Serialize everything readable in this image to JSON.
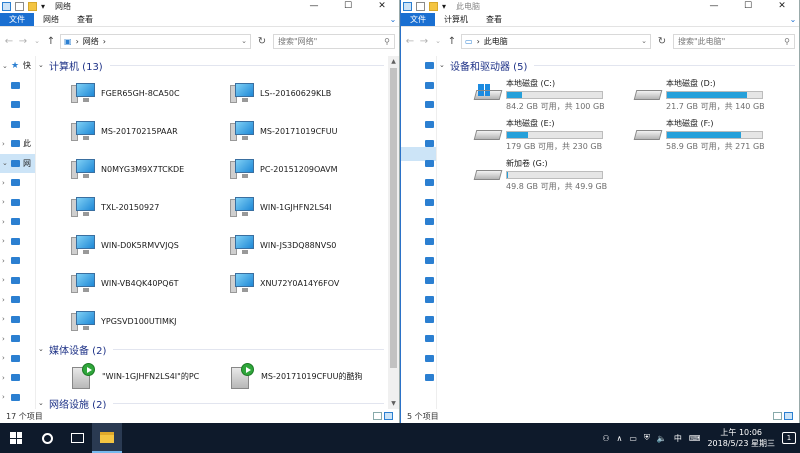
{
  "left_window": {
    "title": "网络",
    "ribbon_tabs": [
      "文件",
      "网络",
      "查看"
    ],
    "address": "网络",
    "search_placeholder": "搜索\"网络\"",
    "groups": {
      "computers": "计算机 (13)",
      "media": "媒体设备 (2)",
      "infra": "网络设施 (2)"
    },
    "computers": [
      "FGER65GH-8CA50C",
      "LS--20160629KLB",
      "MS-20170215PAAR",
      "MS-20171019CFUU",
      "N0MYG3M9X7TCKDE",
      "PC-20151209OAVM",
      "TXL-20150927",
      "WIN-1GJHFN2LS4I",
      "WIN-D0K5RMVVJQS",
      "WIN-JS3DQ88NVS0",
      "WIN-VB4QK40PQ6T",
      "XNU72Y0A14Y6FOV",
      "YPGSVD100UTIMKJ"
    ],
    "media": [
      "\"WIN-1GJHFN2LS4I\"的PC",
      "MS-20171019CFUU的酷狗"
    ],
    "nav_items": [
      "快",
      "",
      "",
      "",
      "此",
      "网",
      "",
      "",
      "",
      "",
      "",
      "",
      "",
      "",
      "",
      "",
      "",
      ""
    ],
    "status": "17 个项目"
  },
  "right_window": {
    "title": "此电脑",
    "ribbon_tabs": [
      "文件",
      "计算机",
      "查看"
    ],
    "address": "此电脑",
    "search_placeholder": "搜索\"此电脑\"",
    "group": "设备和驱动器 (5)",
    "drives": [
      {
        "name": "本地磁盘 (C:)",
        "free": "84.2 GB 可用，共 100 GB",
        "used_pct": 16,
        "system": true
      },
      {
        "name": "本地磁盘 (D:)",
        "free": "21.7 GB 可用，共 140 GB",
        "used_pct": 84,
        "system": false
      },
      {
        "name": "本地磁盘 (E:)",
        "free": "179 GB 可用，共 230 GB",
        "used_pct": 22,
        "system": false
      },
      {
        "name": "本地磁盘 (F:)",
        "free": "58.9 GB 可用，共 271 GB",
        "used_pct": 78,
        "system": false
      },
      {
        "name": "新加卷 (G:)",
        "free": "49.8 GB 可用，共 49.9 GB",
        "used_pct": 1,
        "system": false
      }
    ],
    "status": "5 个项目"
  },
  "taskbar": {
    "time": "上午 10:06",
    "date": "2018/5/23 星期三",
    "ime": "中",
    "notif_count": "1"
  }
}
